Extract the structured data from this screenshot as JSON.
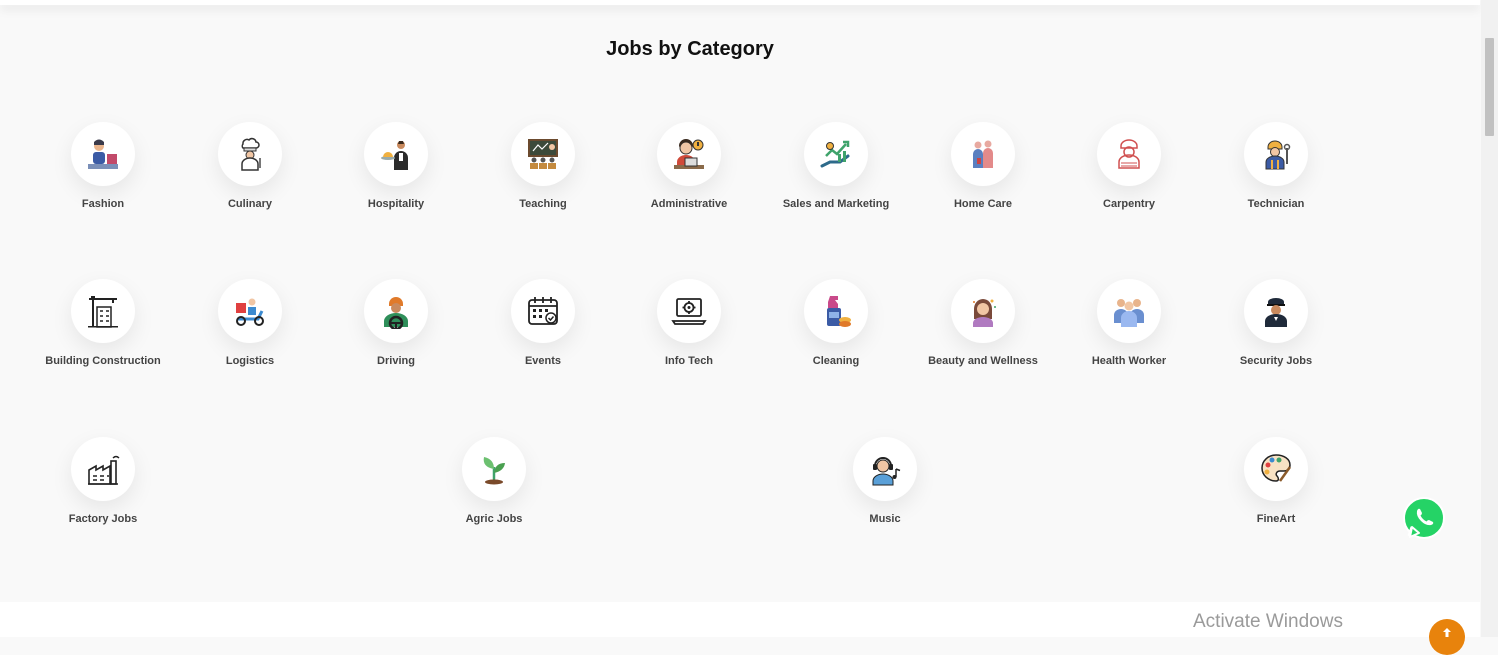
{
  "section": {
    "title": "Jobs by Category"
  },
  "categories": [
    {
      "label": "Fashion",
      "icon": "fashion-icon"
    },
    {
      "label": "Culinary",
      "icon": "chef-icon"
    },
    {
      "label": "Hospitality",
      "icon": "waiter-icon"
    },
    {
      "label": "Teaching",
      "icon": "classroom-icon"
    },
    {
      "label": "Administrative",
      "icon": "admin-desk-icon"
    },
    {
      "label": "Sales and Marketing",
      "icon": "growth-hand-icon"
    },
    {
      "label": "Home Care",
      "icon": "caregiver-icon"
    },
    {
      "label": "Carpentry",
      "icon": "carpenter-icon"
    },
    {
      "label": "Technician",
      "icon": "technician-icon"
    },
    {
      "label": "Building Construction",
      "icon": "crane-building-icon"
    },
    {
      "label": "Logistics",
      "icon": "delivery-scooter-icon"
    },
    {
      "label": "Driving",
      "icon": "driver-icon"
    },
    {
      "label": "Events",
      "icon": "calendar-icon"
    },
    {
      "label": "Info Tech",
      "icon": "laptop-gear-icon"
    },
    {
      "label": "Cleaning",
      "icon": "cleaning-supplies-icon"
    },
    {
      "label": "Beauty and Wellness",
      "icon": "beauty-woman-icon"
    },
    {
      "label": "Health Worker",
      "icon": "health-workers-icon"
    },
    {
      "label": "Security Jobs",
      "icon": "security-guard-icon"
    },
    {
      "label": "Factory Jobs",
      "icon": "factory-icon"
    },
    {
      "label": "Agric Jobs",
      "icon": "sprout-icon"
    },
    {
      "label": "Music",
      "icon": "music-headphones-icon"
    },
    {
      "label": "FineArt",
      "icon": "paint-palette-icon"
    }
  ],
  "overlay": {
    "activate_windows": "Activate Windows"
  },
  "colors": {
    "accent_orange": "#e8830c",
    "whatsapp_green": "#25d366"
  }
}
